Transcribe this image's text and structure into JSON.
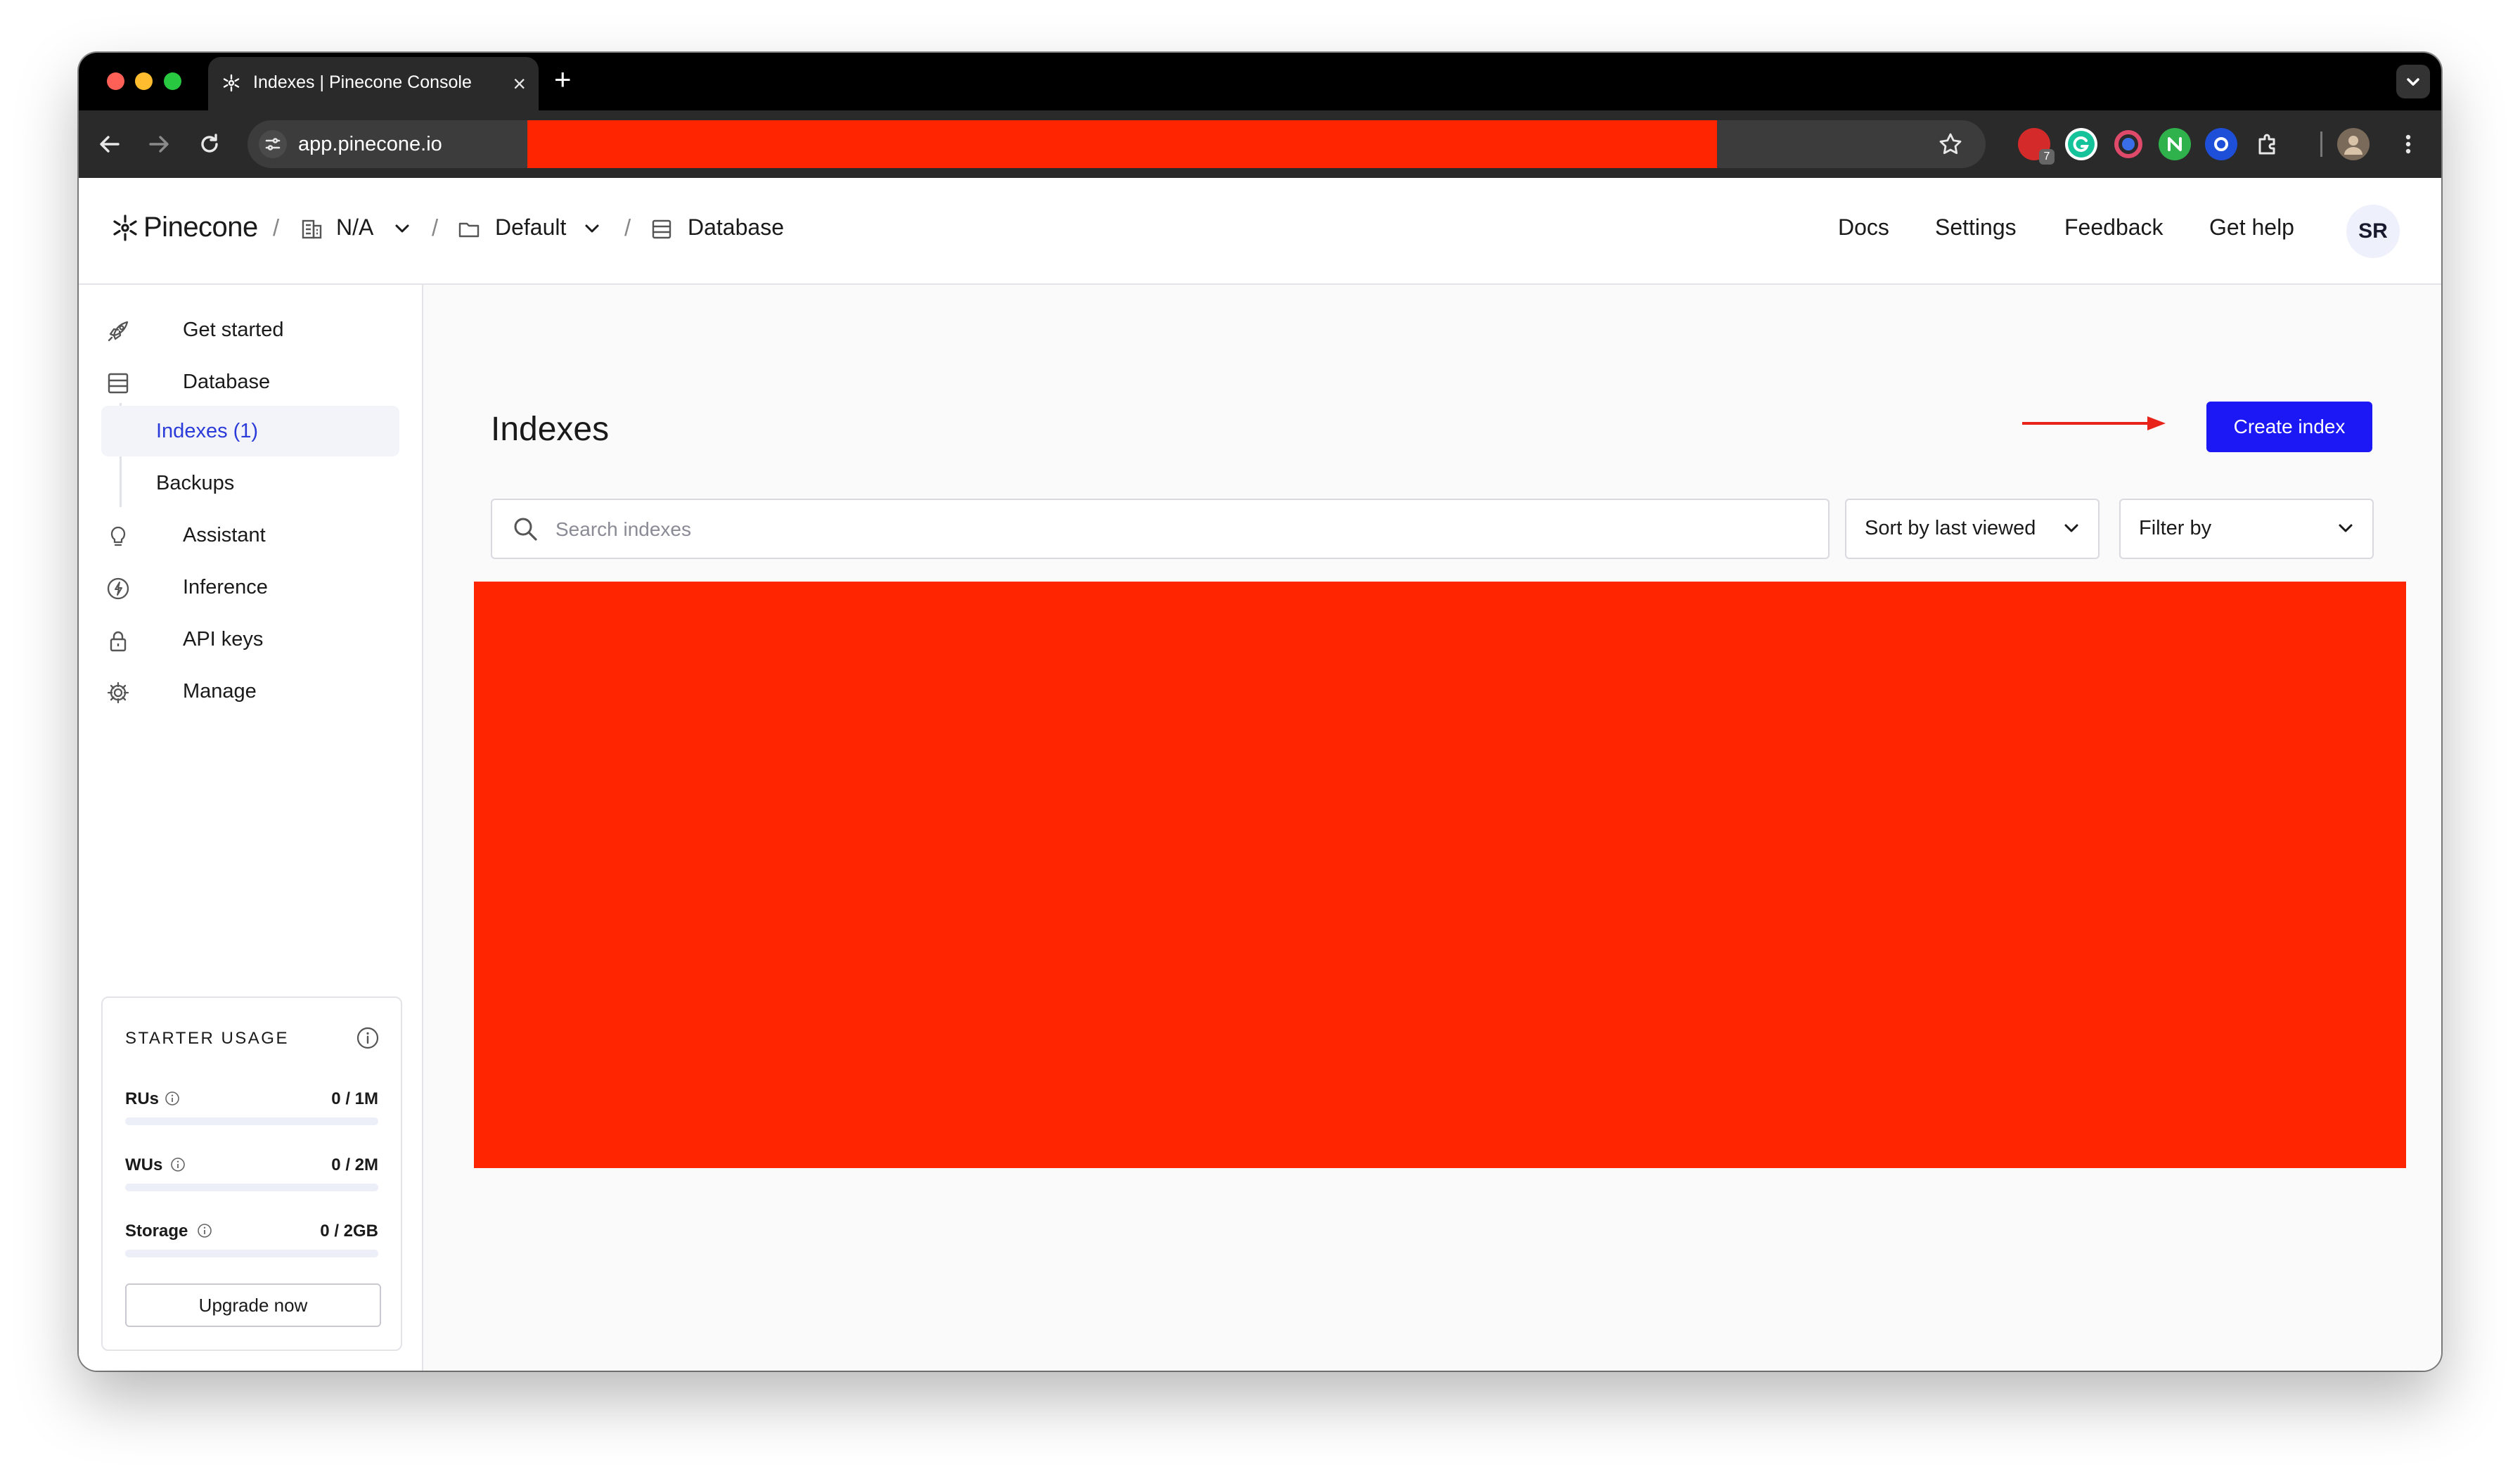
{
  "browser": {
    "tab_title": "Indexes | Pinecone Console",
    "tab_close": "×",
    "new_tab": "+",
    "url": "app.pinecone.io",
    "extension_badge": "7"
  },
  "header": {
    "brand": "Pinecone",
    "separator": "/",
    "breadcrumbs": [
      {
        "label": "N/A"
      },
      {
        "label": "Default"
      },
      {
        "label": "Database"
      }
    ],
    "links": [
      "Docs",
      "Settings",
      "Feedback",
      "Get help"
    ],
    "avatar_initials": "SR"
  },
  "sidebar": {
    "items": [
      {
        "label": "Get started",
        "icon": "rocket-icon"
      },
      {
        "label": "Database",
        "icon": "database-icon"
      },
      {
        "label": "Assistant",
        "icon": "lightbulb-icon"
      },
      {
        "label": "Inference",
        "icon": "bolt-icon"
      },
      {
        "label": "API keys",
        "icon": "lock-icon"
      },
      {
        "label": "Manage",
        "icon": "gear-icon"
      }
    ],
    "subitems": [
      {
        "label": "Indexes (1)",
        "active": true
      },
      {
        "label": "Backups",
        "active": false
      }
    ],
    "usage": {
      "title": "STARTER USAGE",
      "rows": [
        {
          "label": "RUs",
          "value": "0 / 1M",
          "fraction": 0
        },
        {
          "label": "WUs",
          "value": "0 / 2M",
          "fraction": 0
        },
        {
          "label": "Storage",
          "value": "0 / 2GB",
          "fraction": 0
        }
      ],
      "upgrade_label": "Upgrade now"
    }
  },
  "main": {
    "title": "Indexes",
    "create_label": "Create index",
    "search_placeholder": "Search indexes",
    "sort_label": "Sort by last viewed",
    "filter_label": "Filter by"
  },
  "colors": {
    "accent": "#1b17f5",
    "active_text": "#2b3bd9",
    "redaction": "#fe2500",
    "annotation_arrow": "#e8231a"
  }
}
